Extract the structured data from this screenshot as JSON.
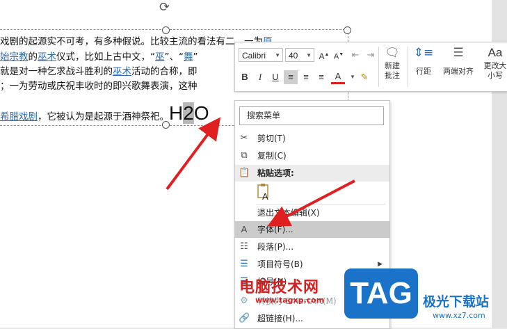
{
  "document": {
    "line1": [
      {
        "t": "戏剧的起源实不可考，有多种假说。比较主流的看法有二，一为"
      },
      {
        "t": "原",
        "link": true
      }
    ],
    "line2": [
      {
        "t": "始宗教",
        "link": true
      },
      {
        "t": "的"
      },
      {
        "t": "巫术",
        "link": true
      },
      {
        "t": "仪式，比如上古中文，“"
      },
      {
        "t": "巫",
        "link": true
      },
      {
        "t": "”、“"
      },
      {
        "t": "舞",
        "link": true
      },
      {
        "t": "”"
      }
    ],
    "line3": [
      {
        "t": "就是对一种乞求战斗胜利的"
      },
      {
        "t": "巫术",
        "link": true
      },
      {
        "t": "活动的合称，即"
      }
    ],
    "line4": [
      {
        "t": "；一为劳动或庆祝丰收时的即兴歌舞表演，这种"
      }
    ],
    "line5": [
      {
        "t": "希腊戏剧",
        "link": true
      },
      {
        "t": "，它被认为是起源于酒神祭祀。"
      }
    ],
    "formula": {
      "h": "H",
      "two": "2",
      "o": "O"
    }
  },
  "mini_toolbar": {
    "font_name": "Calibri",
    "font_size": "40",
    "bold": "B",
    "italic": "I",
    "underline": "U",
    "font_color_letter": "A",
    "new_comment": "新建\n批注",
    "line_spacing": "行距",
    "distribute": "两端对齐",
    "change_case": "更改大\n小写",
    "change_case_icon": "Aa"
  },
  "context_menu": {
    "search_label": "搜索菜单",
    "items": [
      {
        "label": "剪切(T)",
        "icon": "scissors-icon"
      },
      {
        "label": "复制(C)",
        "icon": "copy-icon"
      },
      {
        "label": "粘贴选项:",
        "icon": "paste-icon",
        "header": true
      },
      {
        "label": "退出文本编辑(X)",
        "icon": ""
      },
      {
        "label": "字体(F)...",
        "icon": "font-icon",
        "highlight": true
      },
      {
        "label": "段落(P)...",
        "icon": "paragraph-icon"
      },
      {
        "label": "项目符号(B)",
        "icon": "bullets-icon",
        "submenu": true
      },
      {
        "label": "编号(N)",
        "icon": "numbering-icon",
        "submenu": true
      },
      {
        "label": "转换为 SmartArt(M)",
        "icon": "smartart-icon",
        "dim": true
      },
      {
        "label": "超链接(H)...",
        "icon": "link-icon"
      }
    ]
  },
  "watermark": {
    "site_cn": "电脑技术网",
    "site_url": "www.tagxp.com",
    "tag": "TAG",
    "brand": "极光下载站",
    "brand_url": "www.xz7.com"
  },
  "colors": {
    "arrow": "#e02020",
    "link": "#2b6cb0",
    "highlight": "#cbcbcb",
    "tag_blue": "#1a73c8"
  }
}
